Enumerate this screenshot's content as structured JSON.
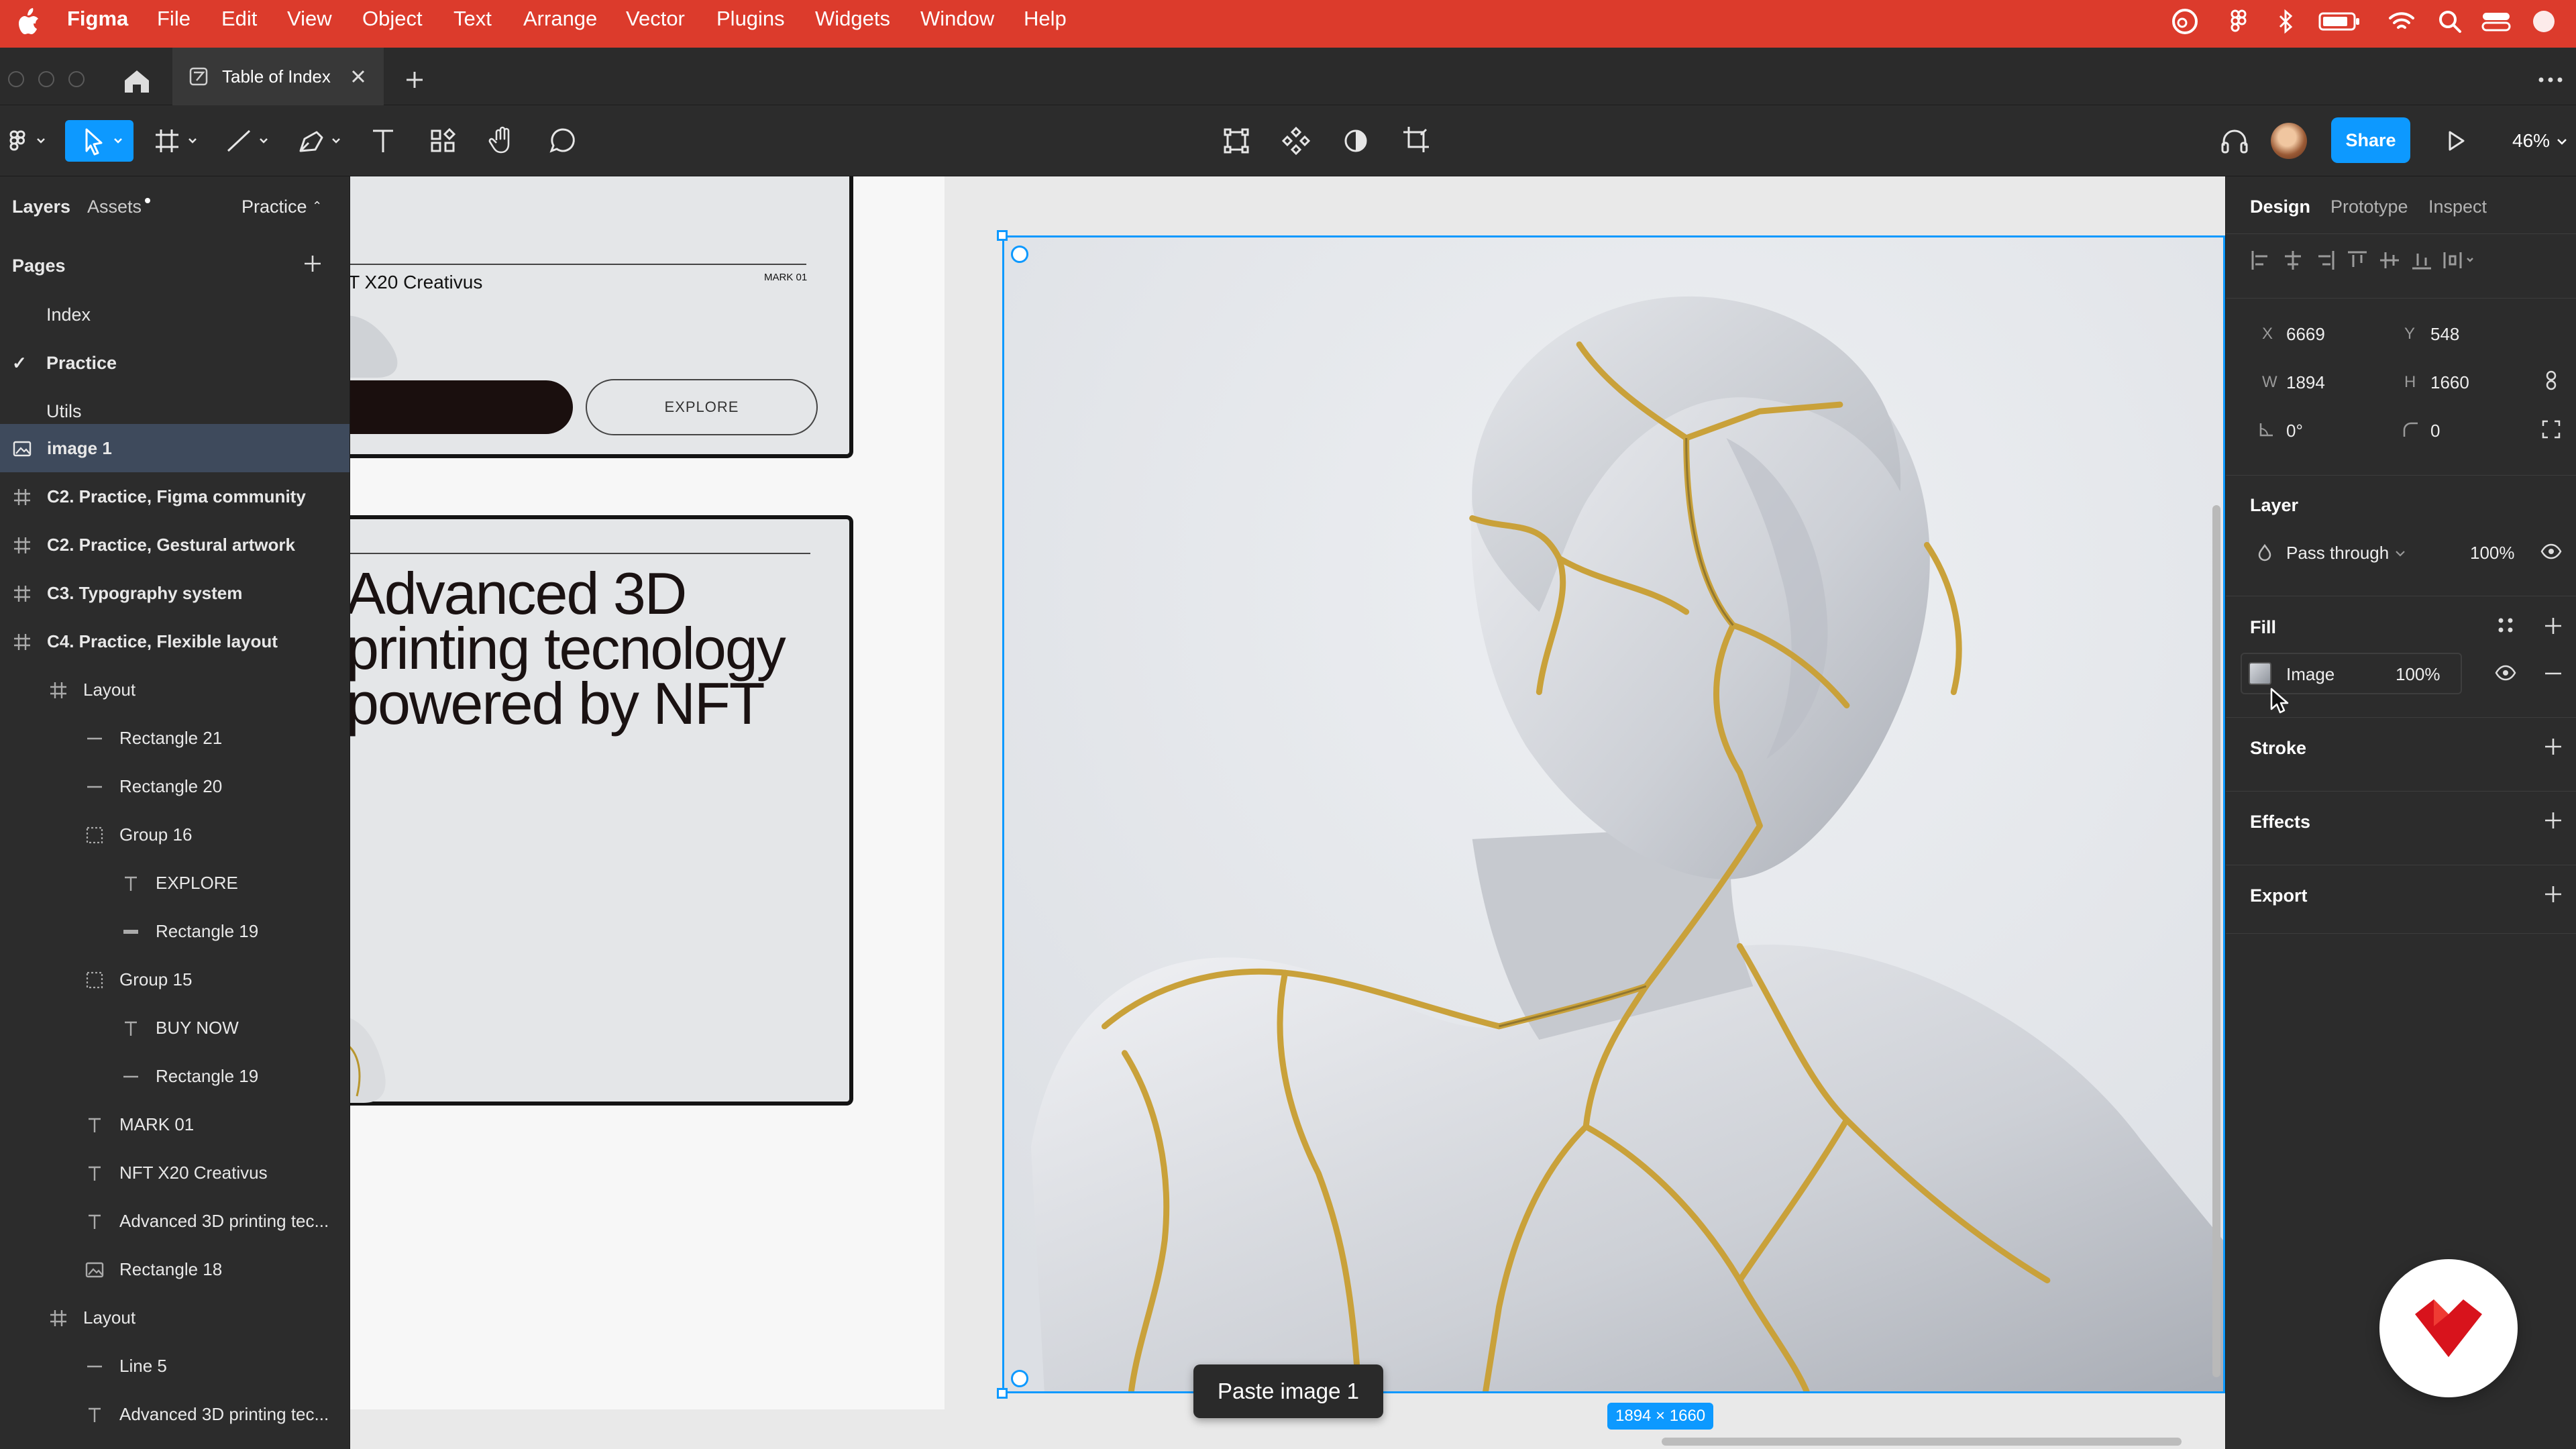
{
  "menubar": {
    "app_name": "Figma",
    "items": [
      "File",
      "Edit",
      "View",
      "Object",
      "Text",
      "Arrange",
      "Vector",
      "Plugins",
      "Widgets",
      "Window",
      "Help"
    ],
    "color": "#dc3b2c"
  },
  "tabbar": {
    "active_tab_title": "Table of Index"
  },
  "toolbar": {
    "share_label": "Share",
    "zoom": "46%",
    "accent": "#0d99ff"
  },
  "left_panel": {
    "tabs": {
      "layers": "Layers",
      "assets": "Assets",
      "page": "Practice"
    },
    "pages_heading": "Pages",
    "pages": [
      "Index",
      "Practice",
      "Utils"
    ],
    "current_page": "Practice",
    "layers": [
      {
        "name": "image 1",
        "icon": "image-icon",
        "selected": true
      },
      {
        "name": "C2. Practice, Figma community",
        "icon": "frame-icon"
      },
      {
        "name": "C2. Practice, Gestural artwork",
        "icon": "frame-icon"
      },
      {
        "name": "C3. Typography system",
        "icon": "frame-icon"
      },
      {
        "name": "C4. Practice, Flexible layout",
        "icon": "frame-icon"
      },
      {
        "name": "Layout",
        "icon": "frame-icon"
      },
      {
        "name": "Rectangle 21",
        "icon": "line-icon"
      },
      {
        "name": "Rectangle 20",
        "icon": "line-icon"
      },
      {
        "name": "Group 16",
        "icon": "group-icon"
      },
      {
        "name": "EXPLORE",
        "icon": "text-icon"
      },
      {
        "name": "Rectangle 19",
        "icon": "rect-icon"
      },
      {
        "name": "Group 15",
        "icon": "group-icon"
      },
      {
        "name": "BUY NOW",
        "icon": "text-icon"
      },
      {
        "name": "Rectangle 19",
        "icon": "line-icon"
      },
      {
        "name": "MARK 01",
        "icon": "text-icon"
      },
      {
        "name": "NFT X20 Creativus",
        "icon": "text-icon"
      },
      {
        "name": "Advanced 3D printing tec...",
        "icon": "text-icon"
      },
      {
        "name": "Rectangle 18",
        "icon": "image-icon"
      },
      {
        "name": "Layout",
        "icon": "frame-icon"
      },
      {
        "name": "Line 5",
        "icon": "line-icon"
      },
      {
        "name": "Advanced 3D printing tec...",
        "icon": "text-icon"
      }
    ]
  },
  "canvas": {
    "card1": {
      "nft_text": "FT X20 Creativus",
      "mark": "MARK 01",
      "explore": "EXPLORE"
    },
    "card2": {
      "heading_lines": [
        "Advanced 3D",
        "printing tecnology",
        "powered by NFT"
      ]
    },
    "size_badge": "1894 × 1660",
    "tooltip": "Paste image 1"
  },
  "right_panel": {
    "tabs": [
      "Design",
      "Prototype",
      "Inspect"
    ],
    "x_label": "X",
    "x": "6669",
    "y_label": "Y",
    "y": "548",
    "w_label": "W",
    "w": "1894",
    "h_label": "H",
    "h": "1660",
    "rotation": "0°",
    "radius": "0",
    "layer_heading": "Layer",
    "blend": "Pass through",
    "opacity": "100%",
    "fill_heading": "Fill",
    "fill_type": "Image",
    "fill_opacity": "100%",
    "stroke_heading": "Stroke",
    "effects_heading": "Effects",
    "export_heading": "Export"
  },
  "colors": {
    "panel": "#2c2c2c",
    "selection": "#0d99ff",
    "kintsugi_gold": "#c9a13a"
  }
}
